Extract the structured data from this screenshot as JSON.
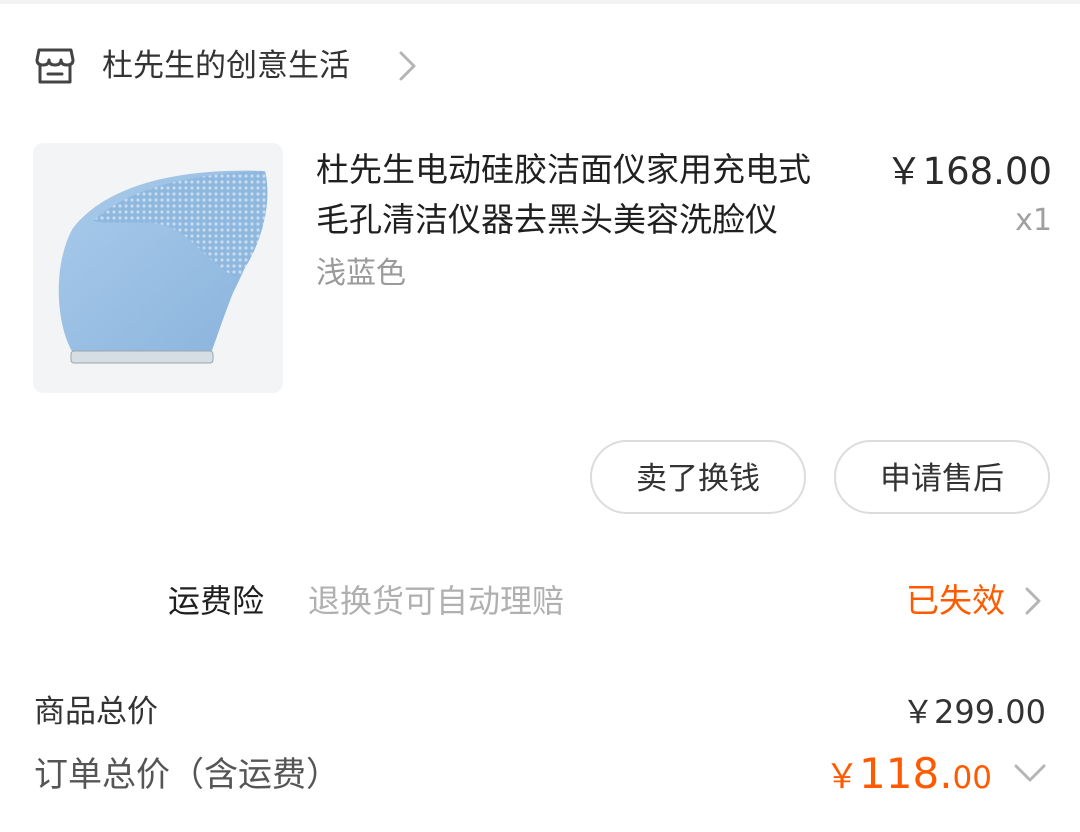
{
  "shop": {
    "name": "杜先生的创意生活",
    "icon": "shop-icon",
    "chevron_icon": "chevron-right-icon"
  },
  "product": {
    "title_line1": "杜先生电动硅胶洁面仪家用充电式",
    "title_line2": "毛孔清洁仪器去黑头美容洗脸仪",
    "variant": "浅蓝色",
    "price": "￥168.00",
    "quantity": "x1",
    "image_color": "#9ec3e6"
  },
  "actions": {
    "sell_label": "卖了换钱",
    "after_sales_label": "申请售后"
  },
  "shipping_insurance": {
    "label": "运费险",
    "description": "退换货可自动理赔",
    "status": "已失效",
    "status_color": "#ff5a00"
  },
  "totals": {
    "goods_total_label": "商品总价",
    "goods_total_value": "￥299.00",
    "order_total_label": "订单总价（含运费）",
    "order_total_currency": "￥",
    "order_total_integer": "118.",
    "order_total_decimal": "00",
    "accent_color": "#ff5a00"
  }
}
